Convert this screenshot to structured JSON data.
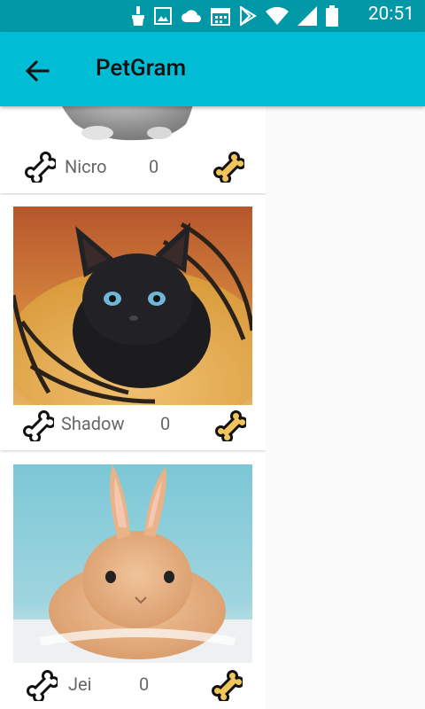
{
  "status_bar": {
    "time": "20:51",
    "icons": [
      "cleaner-icon",
      "image-icon",
      "cloud-icon",
      "calendar-icon",
      "play-store-icon",
      "wifi-icon",
      "signal-icon",
      "battery-icon"
    ]
  },
  "app_bar": {
    "title": "PetGram",
    "back_icon": "arrow-back-icon"
  },
  "posts": [
    {
      "name": "Nicro",
      "likes": "0",
      "image": "gray-kitten-photo"
    },
    {
      "name": "Shadow",
      "likes": "0",
      "image": "black-kitten-photo"
    },
    {
      "name": "Jei",
      "likes": "0",
      "image": "bunny-photo"
    }
  ],
  "colors": {
    "primary": "#00bcd4",
    "primary_dark": "#0097a7",
    "bone_outline": "#111111",
    "bone_filled": "#f2c55c"
  }
}
